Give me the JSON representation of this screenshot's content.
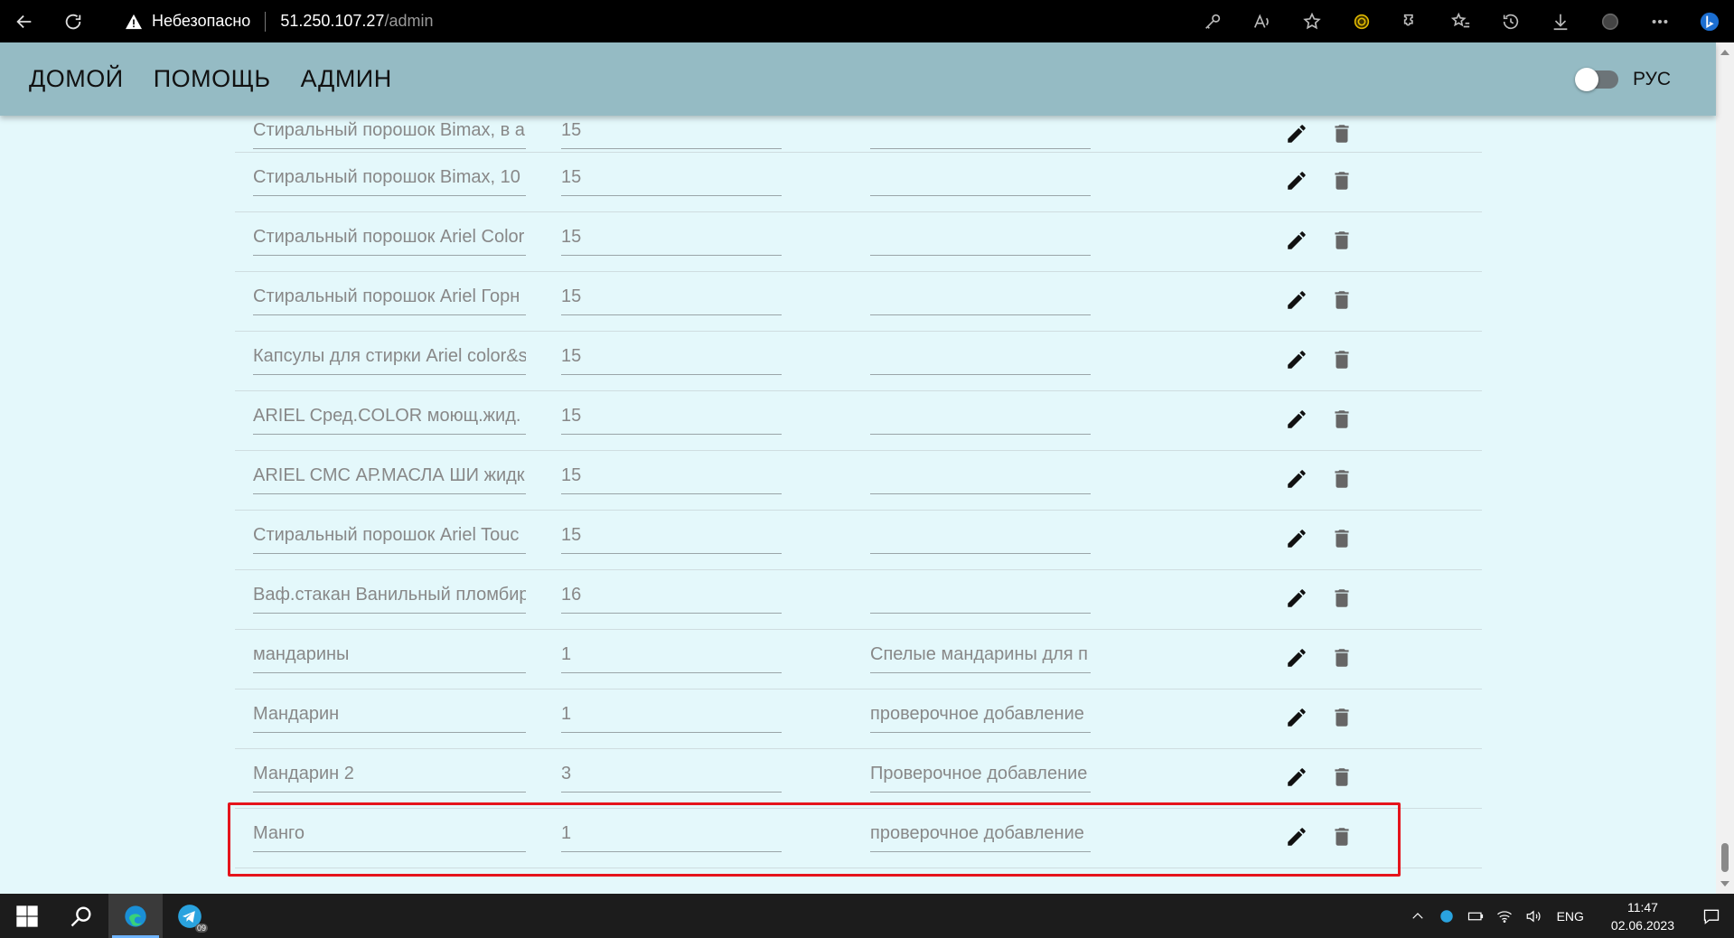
{
  "browser": {
    "security_label": "Небезопасно",
    "url_host": "51.250.107.27",
    "url_path": "/admin"
  },
  "nav": {
    "items": [
      {
        "label": "ДОМОЙ"
      },
      {
        "label": "ПОМОЩЬ"
      },
      {
        "label": "АДМИН"
      }
    ],
    "language_label": "РУС"
  },
  "products": [
    {
      "name": "Стиральный порошок Bimax, в а",
      "qty": "15",
      "desc": ""
    },
    {
      "name": "Стиральный порошок Bimax, 10",
      "qty": "15",
      "desc": ""
    },
    {
      "name": "Стиральный порошок Ariel Color",
      "qty": "15",
      "desc": ""
    },
    {
      "name": "Стиральный порошок Ariel Горн",
      "qty": "15",
      "desc": ""
    },
    {
      "name": "Капсулы для стирки Ariel color&s",
      "qty": "15",
      "desc": ""
    },
    {
      "name": "ARIEL Сред.COLOR моющ.жид.",
      "qty": "15",
      "desc": ""
    },
    {
      "name": "ARIEL СМС АР.МАСЛА ШИ жидк",
      "qty": "15",
      "desc": ""
    },
    {
      "name": "Стиральный порошок Ariel Touc",
      "qty": "15",
      "desc": ""
    },
    {
      "name": "Ваф.стакан Ванильный пломбир",
      "qty": "16",
      "desc": ""
    },
    {
      "name": "мандарины",
      "qty": "1",
      "desc": "Спелые мандарины для п"
    },
    {
      "name": "Мандарин",
      "qty": "1",
      "desc": "проверочное добавление"
    },
    {
      "name": "Мандарин 2",
      "qty": "3",
      "desc": "Проверочное добавление"
    },
    {
      "name": "Манго",
      "qty": "1",
      "desc": "проверочное добавление"
    }
  ],
  "taskbar": {
    "language": "ENG",
    "time": "11:47",
    "date": "02.06.2023",
    "telegram_badge": "09"
  },
  "colors": {
    "header_bg": "#95bbc4",
    "page_bg": "#e4f8fb",
    "highlight": "#e5141c"
  }
}
